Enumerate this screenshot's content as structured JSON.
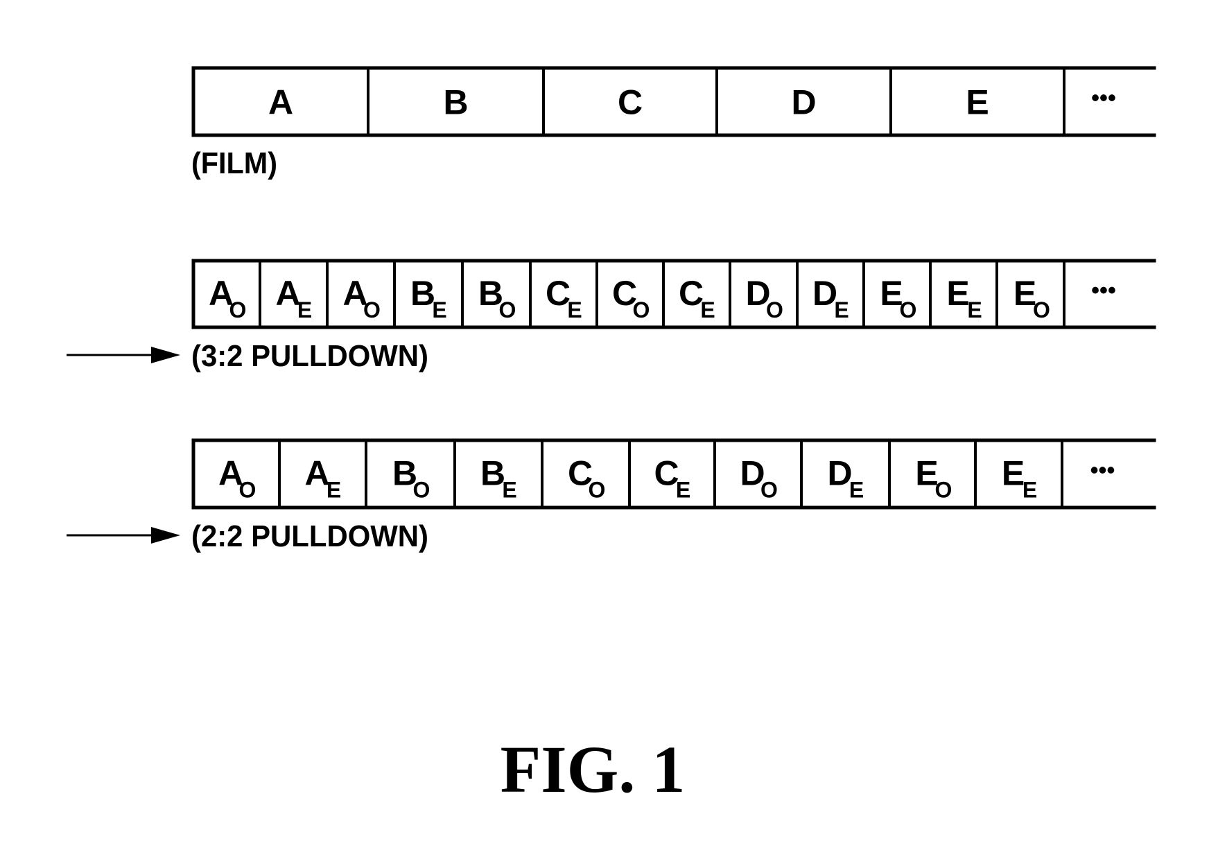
{
  "figure_title": "FIG. 1",
  "rows": [
    {
      "id": "film",
      "label": "(FILM)",
      "has_arrow": false,
      "cells": [
        {
          "main": "A",
          "sub": ""
        },
        {
          "main": "B",
          "sub": ""
        },
        {
          "main": "C",
          "sub": ""
        },
        {
          "main": "D",
          "sub": ""
        },
        {
          "main": "E",
          "sub": ""
        }
      ],
      "continuation": "•••"
    },
    {
      "id": "pulldown-3-2",
      "label": "(3:2 PULLDOWN)",
      "has_arrow": true,
      "cells": [
        {
          "main": "A",
          "sub": "O"
        },
        {
          "main": "A",
          "sub": "E"
        },
        {
          "main": "A",
          "sub": "O"
        },
        {
          "main": "B",
          "sub": "E"
        },
        {
          "main": "B",
          "sub": "O"
        },
        {
          "main": "C",
          "sub": "E"
        },
        {
          "main": "C",
          "sub": "O"
        },
        {
          "main": "C",
          "sub": "E"
        },
        {
          "main": "D",
          "sub": "O"
        },
        {
          "main": "D",
          "sub": "E"
        },
        {
          "main": "E",
          "sub": "O"
        },
        {
          "main": "E",
          "sub": "E"
        },
        {
          "main": "E",
          "sub": "O"
        }
      ],
      "continuation": "•••"
    },
    {
      "id": "pulldown-2-2",
      "label": "(2:2 PULLDOWN)",
      "has_arrow": true,
      "cells": [
        {
          "main": "A",
          "sub": "O"
        },
        {
          "main": "A",
          "sub": "E"
        },
        {
          "main": "B",
          "sub": "O"
        },
        {
          "main": "B",
          "sub": "E"
        },
        {
          "main": "C",
          "sub": "O"
        },
        {
          "main": "C",
          "sub": "E"
        },
        {
          "main": "D",
          "sub": "O"
        },
        {
          "main": "D",
          "sub": "E"
        },
        {
          "main": "E",
          "sub": "O"
        },
        {
          "main": "E",
          "sub": "E"
        }
      ],
      "continuation": "•••"
    }
  ]
}
